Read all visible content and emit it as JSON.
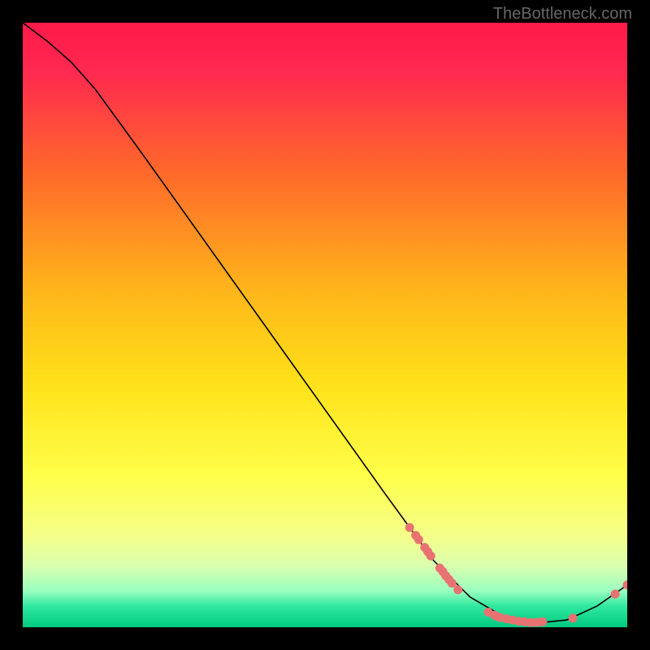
{
  "watermark": "TheBottleneck.com",
  "chart_data": {
    "type": "line",
    "title": "",
    "xlabel": "",
    "ylabel": "",
    "xlim": [
      0,
      100
    ],
    "ylim": [
      0,
      100
    ],
    "gradient_colors": {
      "top": "#ff1a4a",
      "upper_mid": "#ff8c1a",
      "mid": "#ffd700",
      "lower_mid": "#ffff66",
      "low": "#ccff99",
      "bottom": "#00d084"
    },
    "curve": [
      {
        "x": 0,
        "y": 100
      },
      {
        "x": 4,
        "y": 97
      },
      {
        "x": 8,
        "y": 93.5
      },
      {
        "x": 12,
        "y": 89
      },
      {
        "x": 20,
        "y": 78
      },
      {
        "x": 30,
        "y": 64
      },
      {
        "x": 40,
        "y": 50
      },
      {
        "x": 50,
        "y": 36
      },
      {
        "x": 60,
        "y": 22
      },
      {
        "x": 68,
        "y": 11
      },
      {
        "x": 74,
        "y": 5
      },
      {
        "x": 80,
        "y": 1.5
      },
      {
        "x": 86,
        "y": 0.8
      },
      {
        "x": 90,
        "y": 1.2
      },
      {
        "x": 95,
        "y": 3.5
      },
      {
        "x": 100,
        "y": 7
      }
    ],
    "markers": [
      {
        "x": 64,
        "y": 16.5
      },
      {
        "x": 65,
        "y": 15.2
      },
      {
        "x": 65.5,
        "y": 14.5
      },
      {
        "x": 66.5,
        "y": 13.2
      },
      {
        "x": 67,
        "y": 12.5
      },
      {
        "x": 67.5,
        "y": 11.8
      },
      {
        "x": 69,
        "y": 9.8
      },
      {
        "x": 69.5,
        "y": 9.2
      },
      {
        "x": 70,
        "y": 8.5
      },
      {
        "x": 70.5,
        "y": 7.9
      },
      {
        "x": 71,
        "y": 7.3
      },
      {
        "x": 72,
        "y": 6.2
      },
      {
        "x": 77,
        "y": 2.5
      },
      {
        "x": 78,
        "y": 2.0
      },
      {
        "x": 78.5,
        "y": 1.8
      },
      {
        "x": 79,
        "y": 1.6
      },
      {
        "x": 80,
        "y": 1.4
      },
      {
        "x": 81,
        "y": 1.2
      },
      {
        "x": 82,
        "y": 1.0
      },
      {
        "x": 83,
        "y": 0.9
      },
      {
        "x": 84,
        "y": 0.8
      },
      {
        "x": 85,
        "y": 0.8
      },
      {
        "x": 86,
        "y": 0.9
      },
      {
        "x": 91,
        "y": 1.5
      },
      {
        "x": 98,
        "y": 5.5
      },
      {
        "x": 100,
        "y": 7
      }
    ],
    "marker_color": "#e87272"
  }
}
